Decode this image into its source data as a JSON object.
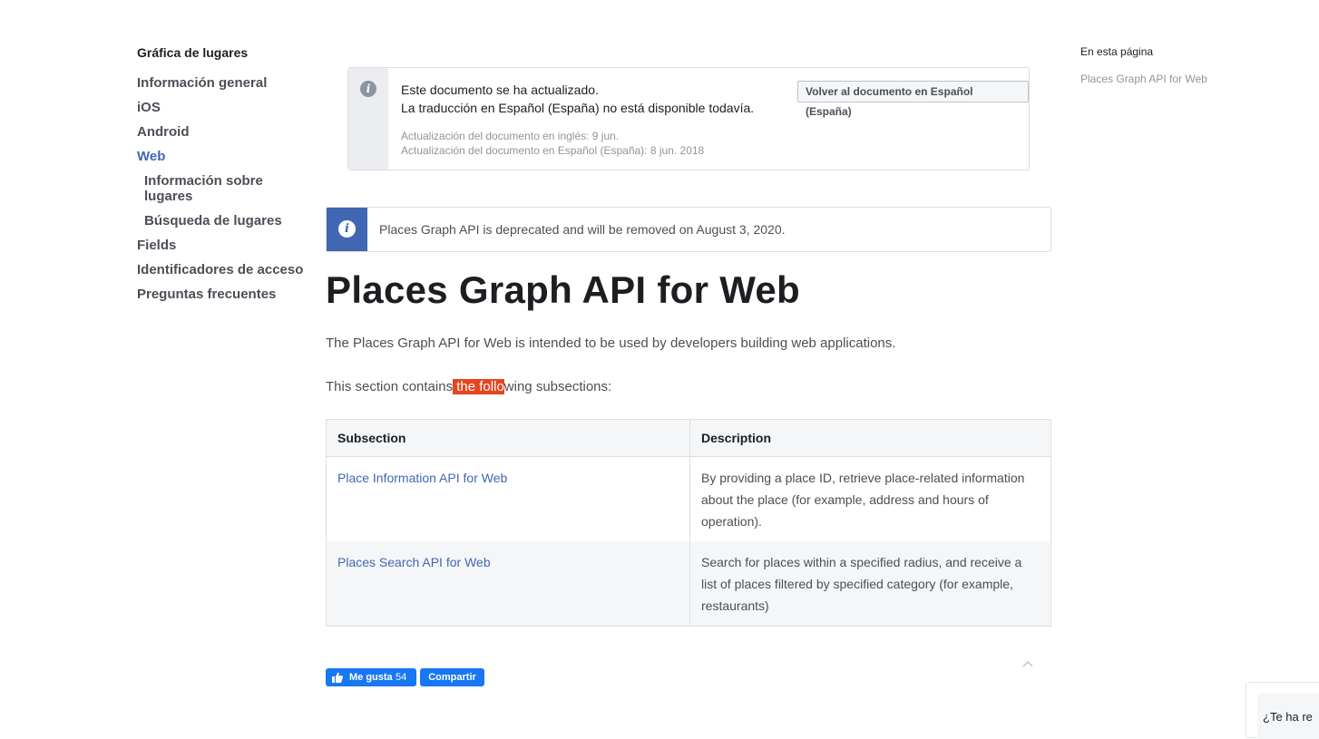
{
  "sidebar": {
    "title": "Gráfica de lugares",
    "items": [
      {
        "label": "Información general"
      },
      {
        "label": "iOS"
      },
      {
        "label": "Android"
      },
      {
        "label": "Web"
      }
    ],
    "subitems": [
      {
        "label": "Información sobre lugares"
      },
      {
        "label": "Búsqueda de lugares"
      }
    ],
    "items_after": [
      {
        "label": "Fields"
      },
      {
        "label": "Identificadores de acceso"
      },
      {
        "label": "Preguntas frecuentes"
      }
    ]
  },
  "toc": {
    "heading": "En esta página",
    "link": "Places Graph API for Web"
  },
  "translation_notice": {
    "line1": "Este documento se ha actualizado.",
    "line2": "La traducción en Español (España) no está disponible todavía.",
    "date_en": "Actualización del documento en inglés: 9 jun.",
    "date_es": "Actualización del documento en Español (España): 8 jun. 2018",
    "button": "Volver al documento en Español (España)"
  },
  "deprecation_notice": {
    "text": "Places Graph API is deprecated and will be removed on August 3, 2020."
  },
  "main": {
    "title": "Places Graph API for Web",
    "intro": "The Places Graph API for Web is intended to be used by developers building web applications.",
    "section_before": "This section contains",
    "section_highlight": " the follo",
    "section_after": "wing subsections:"
  },
  "table": {
    "headers": [
      "Subsection",
      "Description"
    ],
    "rows": [
      {
        "subsection": "Place Information API for Web",
        "description": "By providing a place ID, retrieve place-related information about the place (for example, address and hours of operation)."
      },
      {
        "subsection": "Places Search API for Web",
        "description": "Search for places within a specified radius, and receive a list of places filtered by specified category (for example, restaurants)"
      }
    ]
  },
  "social": {
    "like_label": "Me gusta",
    "like_count": "54",
    "share_label": "Compartir"
  },
  "feedback": {
    "text": "¿Te ha re"
  },
  "colors": {
    "link": "#4267b2",
    "highlight": "#e4461f",
    "facebook_button": "#1877f2"
  }
}
